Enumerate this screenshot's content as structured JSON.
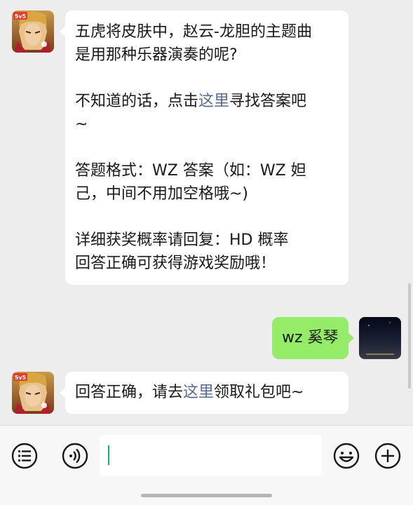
{
  "messages": {
    "msg1": {
      "line1": "五虎将皮肤中，赵云-龙胆的主题曲",
      "line2": "是用那种乐器演奏的呢?",
      "hint_pre": "不知道的话，点击",
      "hint_link": "这里",
      "hint_post": "寻找答案吧",
      "hint_tail": "~",
      "format_line1": "答题格式：WZ 答案（如：WZ 妲",
      "format_line2": "己，中间不用加空格哦~)",
      "detail_line1": "详细获奖概率请回复：HD 概率",
      "detail_line2": "回答正确可获得游戏奖励哦！"
    },
    "msg2": {
      "text": "wz 奚琴"
    },
    "msg3": {
      "pre": "回答正确，请去",
      "link": "这里",
      "post": "领取礼包吧~"
    }
  },
  "avatars": {
    "bot_badge": "5v5"
  },
  "input_bar": {
    "voice_icon": "voice-icon",
    "emoji_icon": "emoji-icon",
    "add_icon": "add-icon",
    "list_icon": "menu-list-icon"
  },
  "colors": {
    "background": "#ededed",
    "bubble_self": "#95ec69",
    "link": "#576b95",
    "caret": "#07c160"
  }
}
